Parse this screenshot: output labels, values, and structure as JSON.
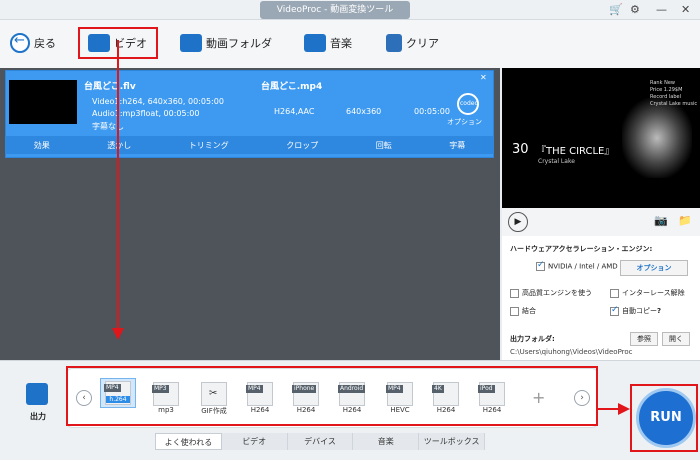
{
  "window": {
    "title": "VideoProc - 動画変換ツール"
  },
  "toolbar": {
    "back_label": "戻る",
    "video_label": "ビデオ",
    "folder_label": "動画フォルダ",
    "music_label": "音楽",
    "clear_label": "クリア"
  },
  "media": {
    "source_name": "台風どこ.flv",
    "video_info": "Video1:h264, 640x360, 00:05:00",
    "audio_info": "Audio1:mp3float, 00:05:00",
    "subtitle_info": "字幕なし",
    "output_name": "台風どこ.mp4",
    "out_codec": "H264,AAC",
    "out_res": "640x360",
    "out_time": "00:05:00",
    "codec_badge": "codec",
    "option_label": "オプション",
    "actions": [
      "効果",
      "透かし",
      "トリミング",
      "クロップ",
      "回転",
      "字幕"
    ]
  },
  "preview": {
    "number": "30",
    "title": "『THE CIRCLE』",
    "subtitle": "Crystal Lake",
    "corner_lines": [
      "Rank New",
      "Price 1.29$M",
      "Record label",
      "Crystal Lake music"
    ]
  },
  "settings": {
    "hw_title": "ハードウェアアクセラレーション・エンジン:",
    "hw_option": "NVIDIA / Intel / AMD",
    "option_button": "オプション",
    "hq_engine": "高品質エンジンを使う",
    "deinterlace": "インターレース解除",
    "merge": "結合",
    "auto_copy": "自動コピー",
    "help": "?",
    "output_folder_label": "出力フォルダ:",
    "browse": "参照",
    "open": "開く",
    "output_path": "C:\\Users\\qiuhong\\Videos\\VideoProc"
  },
  "bottom": {
    "output_label": "出力",
    "formats": [
      {
        "tag": "MP4",
        "label": "h.264",
        "name": ""
      },
      {
        "tag": "MP3",
        "label": "",
        "name": "mp3"
      },
      {
        "tag": "",
        "label": "",
        "name": "GIF作成"
      },
      {
        "tag": "MP4",
        "label": "",
        "name": "H264"
      },
      {
        "tag": "iPhone",
        "label": "",
        "name": "H264"
      },
      {
        "tag": "Android",
        "label": "",
        "name": "H264"
      },
      {
        "tag": "MP4",
        "label": "",
        "name": "HEVC"
      },
      {
        "tag": "4K",
        "label": "",
        "name": "H264"
      },
      {
        "tag": "iPod",
        "label": "",
        "name": "H264"
      }
    ],
    "add": "+",
    "tabs": [
      "よく使われる",
      "ビデオ",
      "デバイス",
      "音楽",
      "ツールボックス"
    ],
    "run_label": "RUN"
  },
  "colors": {
    "accent": "#1e73c8",
    "highlight": "#e0161b",
    "card": "#3d9af0"
  }
}
